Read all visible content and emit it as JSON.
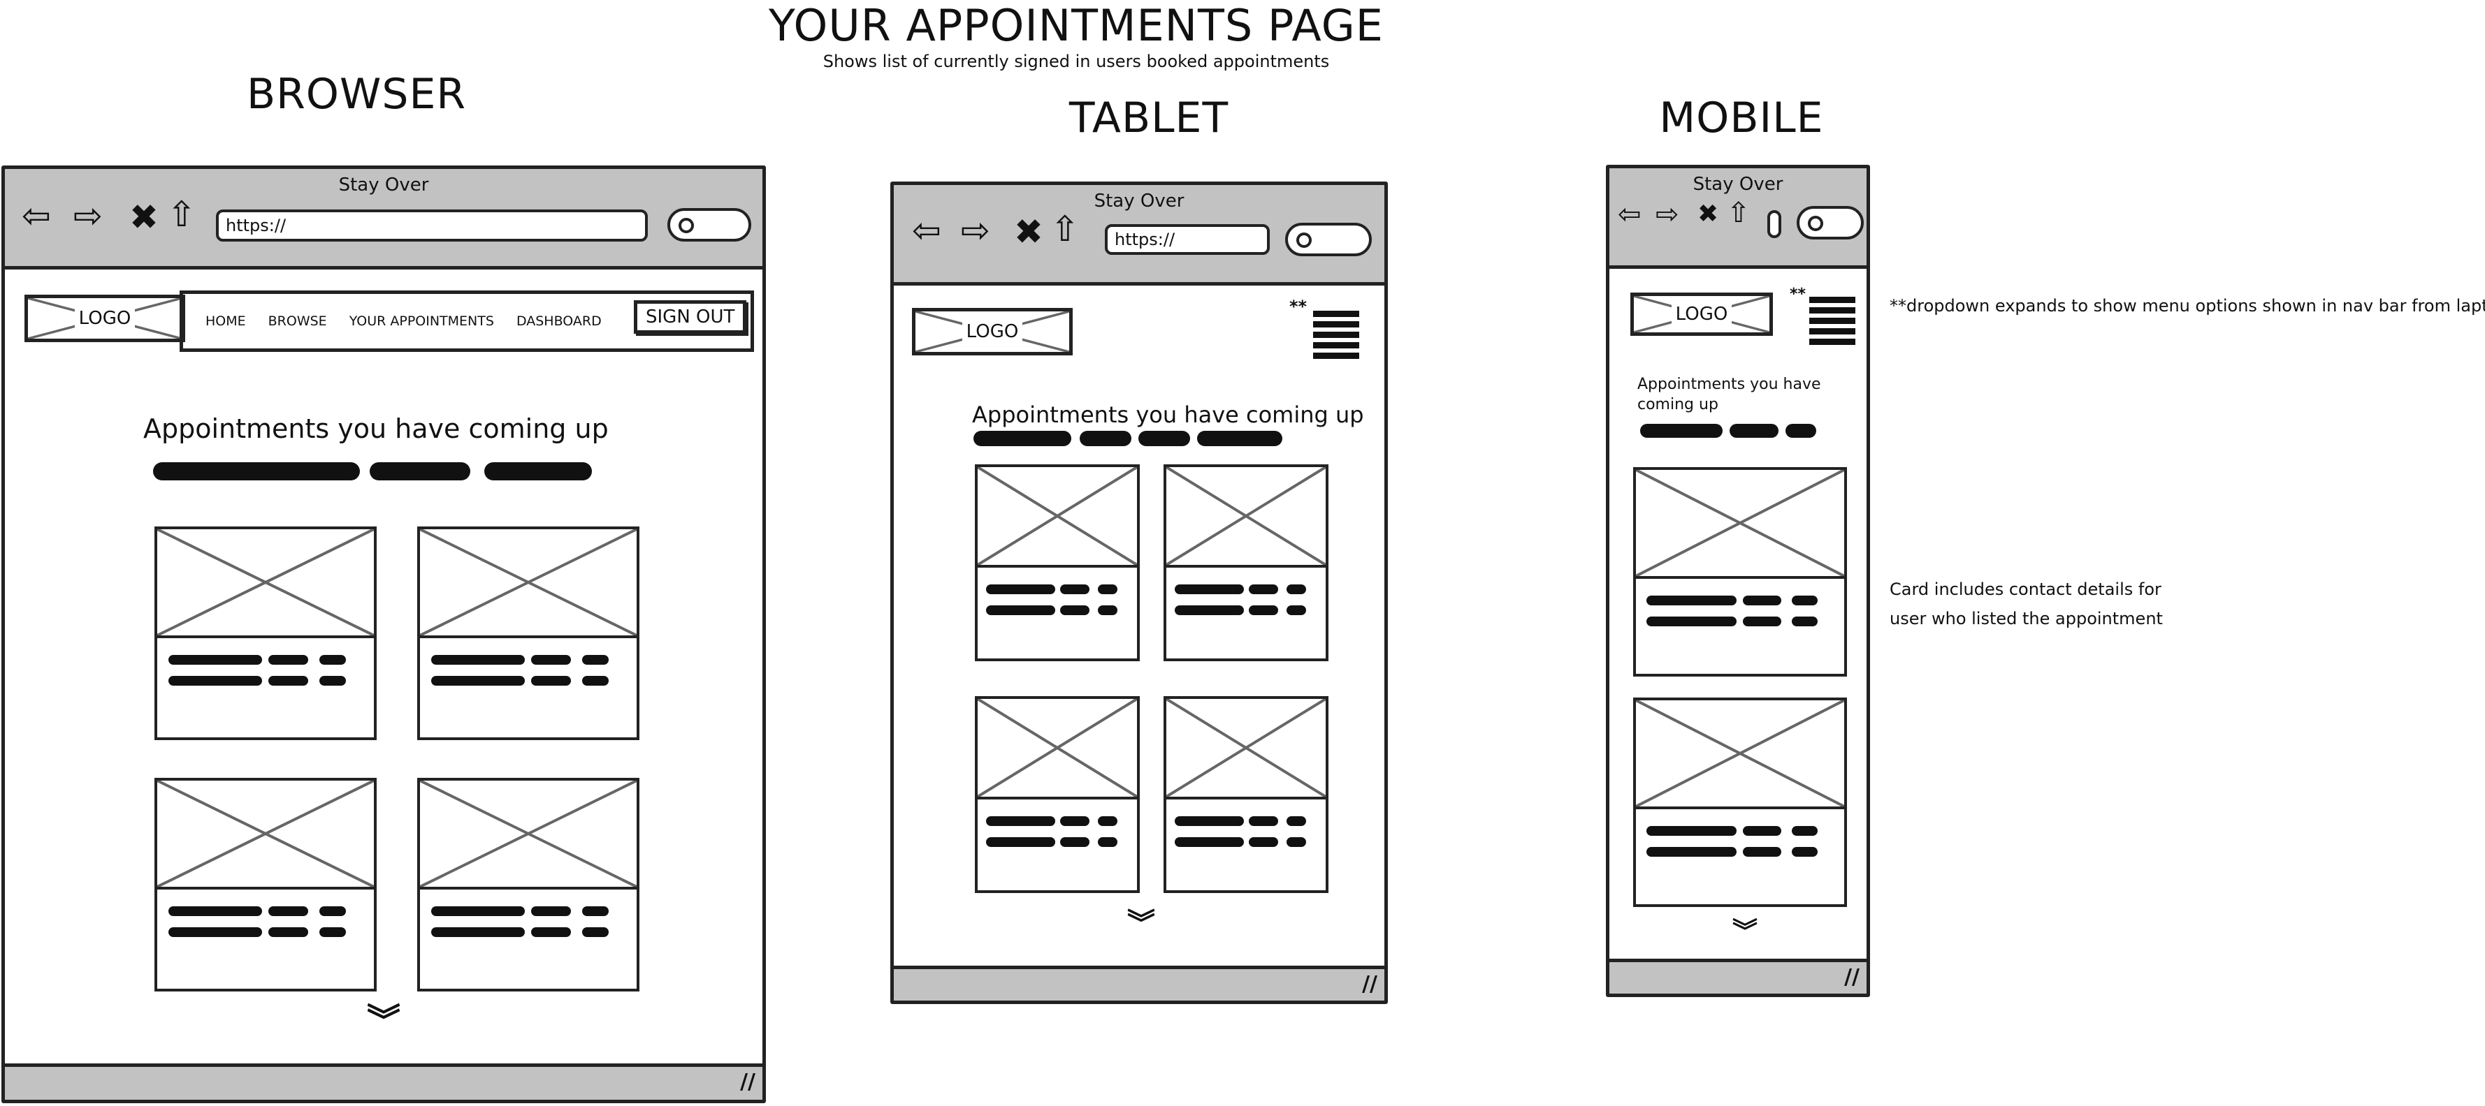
{
  "page": {
    "title": "YOUR APPOINTMENTS PAGE",
    "subtitle": "Shows list of currently signed in users booked appointments"
  },
  "labels": {
    "browser": "BROWSER",
    "tablet": "TABLET",
    "mobile": "MOBILE"
  },
  "window": {
    "title": "Stay Over",
    "url": "https://"
  },
  "nav": {
    "home": "HOME",
    "browse": "BROWSE",
    "appointments": "YOUR APPOINTMENTS",
    "dashboard": "DASHBOARD",
    "sign_out": "SIGN OUT"
  },
  "logo": "LOGO",
  "content": {
    "heading": "Appointments you have coming up"
  },
  "menu_marker": "**",
  "notes": {
    "dropdown": "**dropdown expands to show menu options shown in nav bar from laptop",
    "card_line1": "Card includes contact details for",
    "card_line2": "user who listed the appointment"
  },
  "icons": {
    "back": "back-arrow-icon",
    "forward": "forward-arrow-icon",
    "stop": "close-icon",
    "home": "home-icon",
    "search": "search-icon",
    "menu": "hamburger-menu-icon",
    "scroll": "chevron-double-down-icon",
    "resize": "resize-grip-icon"
  },
  "colors": {
    "chrome": "#c2c2c2",
    "ink": "#222222"
  }
}
